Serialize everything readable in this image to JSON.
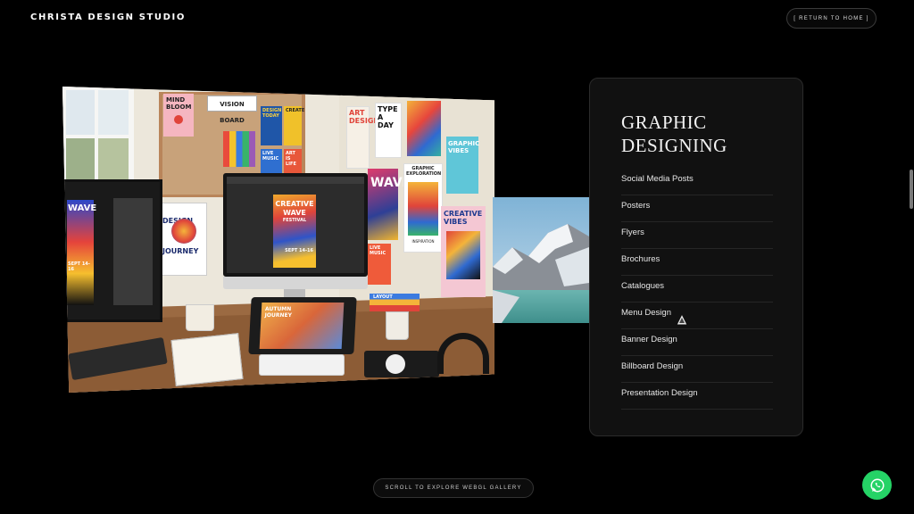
{
  "header": {
    "brand": "CHRISTA DESIGN STUDIO",
    "return_label": "[ RETURN TO HOME ]"
  },
  "card": {
    "title": "GRAPHIC DESIGNING",
    "services": [
      "Social Media Posts",
      "Posters",
      "Flyers",
      "Brochures",
      "Catalogues",
      "Menu Design",
      "Banner Design",
      "Billboard Design",
      "Presentation Design"
    ]
  },
  "photo": {
    "posters": {
      "mind_bloom": "MIND BLOOM",
      "vision_board": "VISION BOARD",
      "design_today": "DESIGN TODAY",
      "create": "CREATE",
      "live_music": "LIVE MUSIC",
      "art_life": "ART IS LIFE",
      "art_design": "ART DESIGN",
      "type_day": "TYPE A DAY",
      "graphic_vibes": "GRAPHIC VIBES",
      "graphic_exploration": "GRAPHIC EXPLORATION",
      "creative_vibes": "CREATIVE VIBES",
      "inspiration": "INSPIRATION",
      "design_journey": "DESIGN JOURNEY",
      "creative_wave": "CREATIVE WAVE",
      "festival": "FESTIVAL",
      "sept": "SEPT 14-16",
      "autumn_journey": "AUTUMN JOURNEY",
      "layout": "LAYOUT",
      "wave": "WAVE"
    }
  },
  "footer": {
    "scroll_hint": "SCROLL TO EXPLORE WEBGL GALLERY"
  },
  "colors": {
    "background": "#000000",
    "card_bg": "#111111",
    "whatsapp": "#25d366"
  }
}
